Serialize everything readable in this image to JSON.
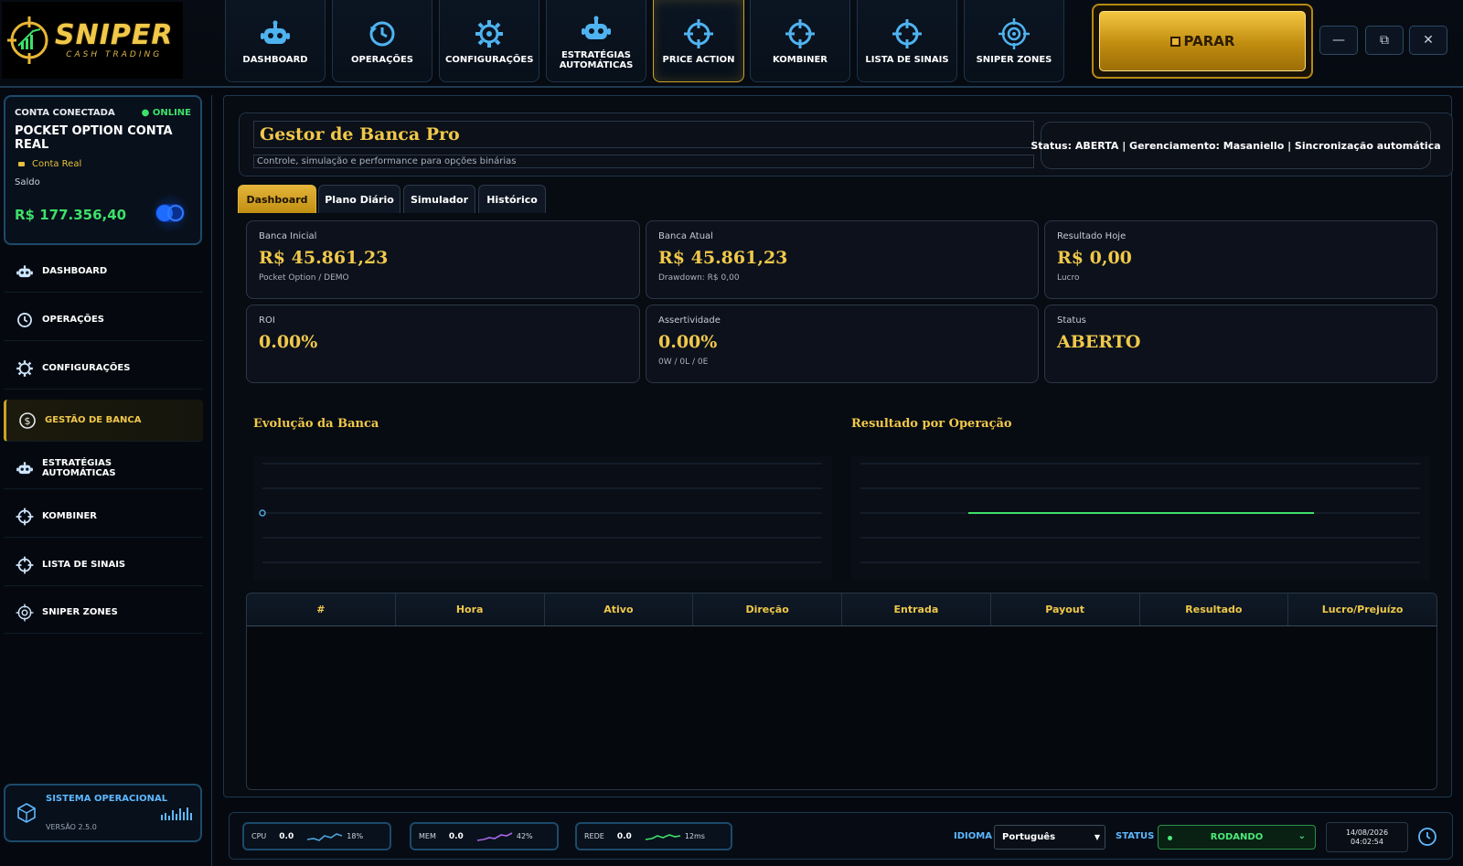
{
  "brand": {
    "name": "SNIPER",
    "tagline": "CASH TRADING"
  },
  "nav": [
    {
      "label": "DASHBOARD",
      "icon": "robot-icon"
    },
    {
      "label": "OPERAÇÕES",
      "icon": "clock-history-icon"
    },
    {
      "label": "CONFIGURAÇÕES",
      "icon": "gear-icon"
    },
    {
      "label": "ESTRATÉGIAS AUTOMÁTICAS",
      "icon": "robot-icon"
    },
    {
      "label": "PRICE ACTION",
      "icon": "crosshair-icon",
      "active": true
    },
    {
      "label": "KOMBINER",
      "icon": "crosshair-icon"
    },
    {
      "label": "LISTA DE SINAIS",
      "icon": "crosshair-icon"
    },
    {
      "label": "SNIPER ZONES",
      "icon": "target-icon"
    }
  ],
  "stop_button": {
    "label": "PARAR"
  },
  "window_controls": {
    "minimize": "—",
    "restore": "⧉",
    "close": "✕"
  },
  "account": {
    "connected_label": "CONTA CONECTADA",
    "status": "ONLINE",
    "name": "POCKET OPTION CONTA REAL",
    "type": "Conta Real",
    "balance_label": "Saldo",
    "balance": "R$ 177.356,40"
  },
  "sidebar": [
    {
      "label": "DASHBOARD",
      "icon": "robot-icon"
    },
    {
      "label": "OPERAÇÕES",
      "icon": "clock-history-icon"
    },
    {
      "label": "CONFIGURAÇÕES",
      "icon": "gear-icon"
    },
    {
      "label": "GESTÃO DE BANCA",
      "icon": "dollar-icon",
      "active": true
    },
    {
      "label": "ESTRATÉGIAS AUTOMÁTICAS",
      "icon": "robot-icon"
    },
    {
      "label": "KOMBINER",
      "icon": "crosshair-icon"
    },
    {
      "label": "LISTA DE SINAIS",
      "icon": "crosshair-icon"
    },
    {
      "label": "SNIPER ZONES",
      "icon": "target-icon"
    }
  ],
  "system": {
    "title": "SISTEMA OPERACIONAL",
    "version": "VERSÃO 2.5.0"
  },
  "page": {
    "title": "Gestor de Banca Pro",
    "subtitle": "Controle, simulação e performance para opções binárias",
    "status_line": "Status: ABERTA | Gerenciamento: Masaniello | Sincronização automática"
  },
  "tabs": [
    "Dashboard",
    "Plano Diário",
    "Simulador",
    "Histórico"
  ],
  "cards": [
    {
      "label": "Banca Inicial",
      "value": "R$ 45.861,23",
      "sub": "Pocket Option / DEMO"
    },
    {
      "label": "Banca Atual",
      "value": "R$ 45.861,23",
      "sub": "Drawdown: R$ 0,00"
    },
    {
      "label": "Resultado Hoje",
      "value": "R$ 0,00",
      "sub": "Lucro"
    },
    {
      "label": "ROI",
      "value": "0.00%",
      "sub": ""
    },
    {
      "label": "Assertividade",
      "value": "0.00%",
      "sub": "0W / 0L / 0E"
    },
    {
      "label": "Status",
      "value": "ABERTO",
      "sub": ""
    }
  ],
  "charts": {
    "left_title": "Evolução da Banca",
    "right_title": "Resultado por Operação",
    "left_color": "#4fa3d9",
    "right_color": "#3ee069"
  },
  "table": {
    "columns": [
      "#",
      "Hora",
      "Ativo",
      "Direção",
      "Entrada",
      "Payout",
      "Resultado",
      "Lucro/Prejuízo"
    ],
    "rows": []
  },
  "metrics": [
    {
      "label": "CPU",
      "value": "0.0",
      "percent": "18%",
      "color": "#4fa3d9"
    },
    {
      "label": "MEM",
      "value": "0.0",
      "percent": "42%",
      "color": "#a865e6"
    },
    {
      "label": "REDE",
      "value": "0.0",
      "percent": "12ms",
      "color": "#3ee069"
    }
  ],
  "footer": {
    "language_label": "IDIOMA",
    "language": "Português",
    "status_label": "STATUS",
    "status": "RODANDO",
    "date": "14/08/2026",
    "time": "04:02:54"
  },
  "colors": {
    "accent": "#f0c84a",
    "online": "#3ee069",
    "info": "#5fb8ff",
    "border": "#1c4a6b"
  }
}
